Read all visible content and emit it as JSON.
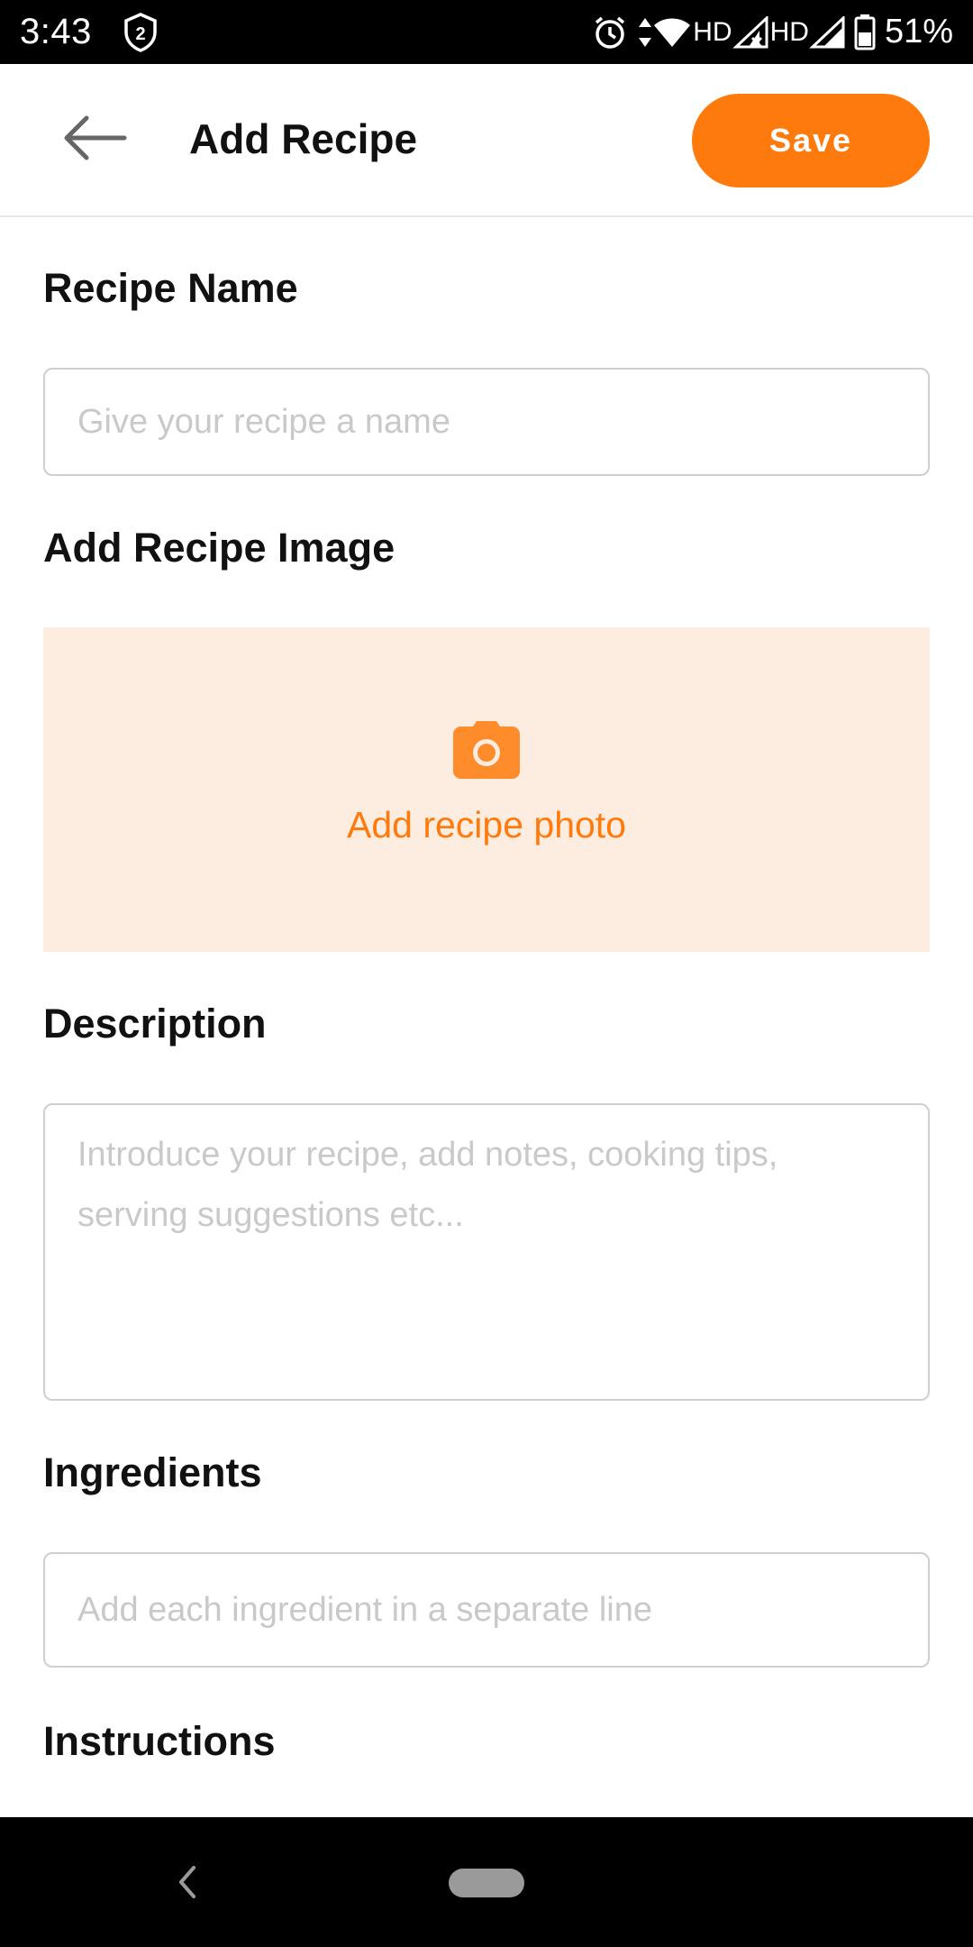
{
  "status_bar": {
    "time": "3:43",
    "notification_badge": "2",
    "network_1": "HD",
    "network_2": "HD",
    "battery_percent": "51%"
  },
  "app_bar": {
    "title": "Add Recipe",
    "save_label": "Save",
    "back_icon": "arrow-left-icon"
  },
  "form": {
    "recipe_name": {
      "label": "Recipe Name",
      "value": "",
      "placeholder": "Give your recipe a name"
    },
    "image": {
      "label": "Add Recipe Image",
      "button_label": "Add recipe photo",
      "icon": "camera-icon"
    },
    "description": {
      "label": "Description",
      "value": "",
      "placeholder_line1": "Introduce your recipe, add notes, cooking tips,",
      "placeholder_line2": "serving suggestions etc..."
    },
    "ingredients": {
      "label": "Ingredients",
      "value": "",
      "placeholder": "Add each ingredient in a separate line"
    },
    "instructions": {
      "label": "Instructions"
    }
  },
  "colors": {
    "accent": "#ff7a0c",
    "photo_zone_bg": "#fdece0",
    "placeholder_text": "#c9c9c9",
    "field_border": "#cfcfcf"
  }
}
